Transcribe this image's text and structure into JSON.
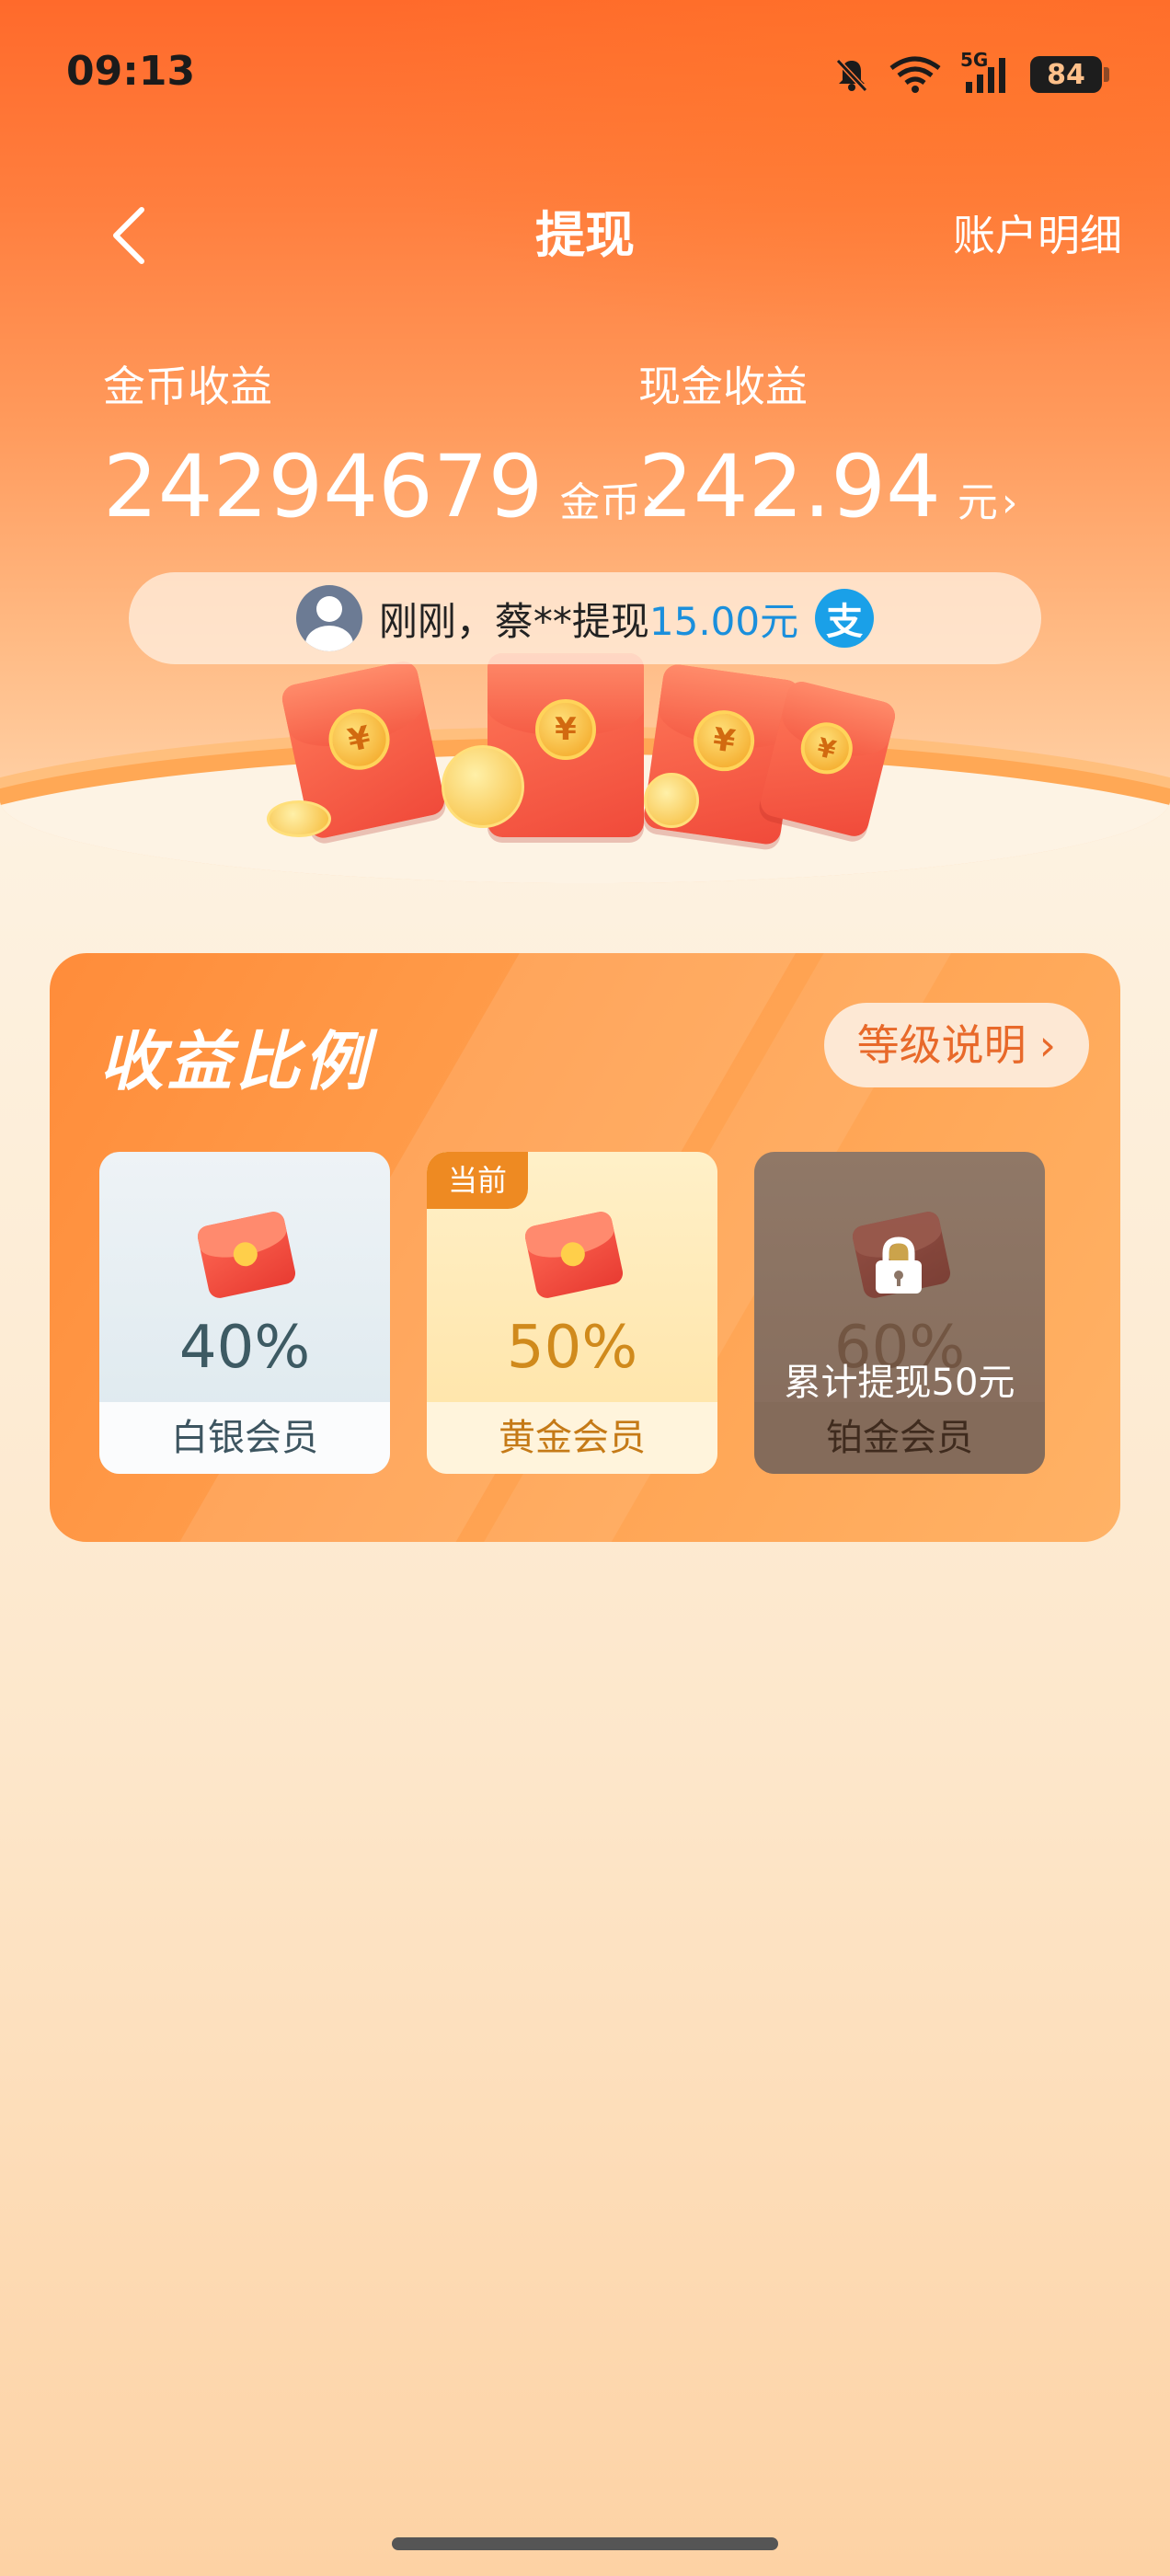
{
  "status_bar": {
    "time": "09:13",
    "network": "5G",
    "battery": "84",
    "icons": [
      "bell-muted-icon",
      "wifi-icon",
      "signal-icon",
      "battery-icon"
    ]
  },
  "nav": {
    "back_icon": "chevron-left-icon",
    "title": "提现",
    "right_link": "账户明细"
  },
  "earnings": {
    "coin": {
      "label": "金币收益",
      "value": "24294679",
      "unit": "金币",
      "arrow": "›"
    },
    "cash": {
      "label": "现金收益",
      "value": "242.94",
      "unit": "元",
      "arrow": "›"
    }
  },
  "ticker": {
    "text": "刚刚，蔡**提现",
    "amount": "15.00元",
    "payment_icon_glyph": "支"
  },
  "ratio_card": {
    "title": "收益比例",
    "level_button": "等级说明",
    "level_button_chevron": "›",
    "tiers": [
      {
        "name": "白银会员",
        "percent": "40%",
        "badge": "",
        "locked": false
      },
      {
        "name": "黄金会员",
        "percent": "50%",
        "badge": "当前",
        "locked": false
      },
      {
        "name": "铂金会员",
        "percent": "60%",
        "badge": "",
        "locked": true,
        "lock_text": "累计提现50元"
      }
    ]
  },
  "colors": {
    "brand_orange": "#ff6a2b",
    "accent_orange": "#e8692a",
    "payment_blue": "#1aa0e8",
    "amount_blue": "#1a8fdc"
  }
}
